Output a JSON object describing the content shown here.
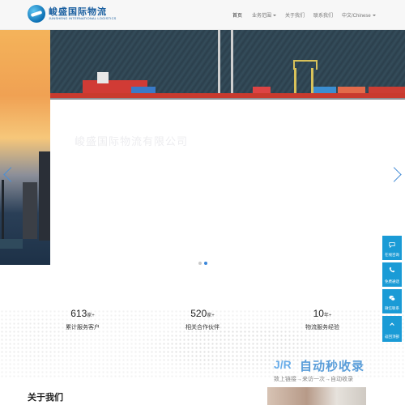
{
  "header": {
    "logo_cn": "峻盛国际物流",
    "logo_en": "JUNSHENG INTERNATIONAL LOGISTICS",
    "nav": [
      {
        "label": "首页",
        "active": true
      },
      {
        "label": "业务范围",
        "dropdown": true
      },
      {
        "label": "关于我们"
      },
      {
        "label": "联系我们"
      },
      {
        "label": "中文/Chinese",
        "dropdown": true
      }
    ]
  },
  "hero": {
    "caption": "峻盛国际物流有限公司",
    "slides": 2,
    "active_slide": 2
  },
  "stats": [
    {
      "value": "613",
      "unit": "家+",
      "label": "累计服务客户"
    },
    {
      "value": "520",
      "unit": "家+",
      "label": "相关合作伙伴"
    },
    {
      "value": "10",
      "unit": "年+",
      "label": "物流服务经验"
    }
  ],
  "about": {
    "title": "关于我们"
  },
  "watermark": {
    "logo": "J/R",
    "text": "自动秒收录",
    "sub": "致上链接→来访一次→自动收录"
  },
  "float_bar": [
    {
      "label": "在线咨询",
      "icon": "chat-icon"
    },
    {
      "label": "免费通话",
      "icon": "phone-icon"
    },
    {
      "label": "微信联系",
      "icon": "wechat-icon"
    },
    {
      "label": "返回顶部",
      "icon": "arrow-up-icon"
    }
  ],
  "colors": {
    "accent": "#1a9bd6",
    "arrow": "#4a8fd6",
    "dot_active": "#3a86d9"
  }
}
